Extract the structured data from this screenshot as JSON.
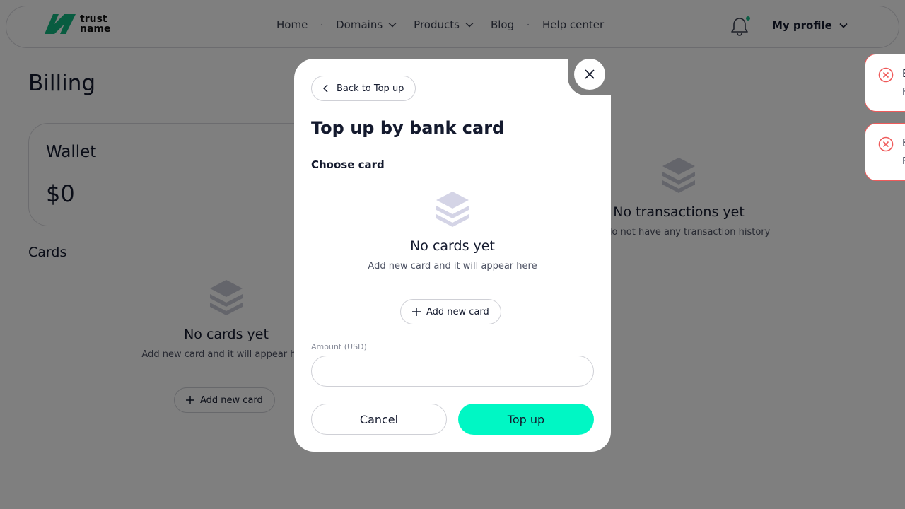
{
  "brand": {
    "logo_line1": "trust",
    "logo_line2": "name",
    "color": "#10b981"
  },
  "nav": {
    "items": [
      {
        "label": "Home"
      },
      {
        "label": "Domains"
      },
      {
        "label": "Products"
      },
      {
        "label": "Blog"
      },
      {
        "label": "Help center"
      }
    ],
    "separator": "·"
  },
  "header": {
    "profile_label": "My profile",
    "notification_badge_color": "#1bbf8c"
  },
  "page": {
    "title": "Billing",
    "wallet": {
      "label": "Wallet",
      "balance": "$0"
    },
    "cards": {
      "title": "Cards",
      "empty_title": "No cards yet",
      "empty_subtitle": "Add new card and it will appear here",
      "add_button": "Add new card"
    },
    "transactions": {
      "empty_title": "No transactions yet",
      "empty_subtitle": "You do not have any transaction history"
    }
  },
  "toasts": [
    {
      "title": "E",
      "message": "F",
      "color": "#ef5a5a"
    },
    {
      "title": "E",
      "message": "F",
      "color": "#ef5a5a"
    }
  ],
  "modal": {
    "back_button": "Back to Top up",
    "title": "Top up by bank card",
    "choose_card_label": "Choose card",
    "empty_title": "No cards yet",
    "empty_subtitle": "Add new card and it will appear here",
    "add_button": "Add new card",
    "amount_label": "Amount (USD)",
    "amount_value": "",
    "cancel_button": "Cancel",
    "submit_button": "Top up",
    "accent_color": "#00f7c4"
  }
}
